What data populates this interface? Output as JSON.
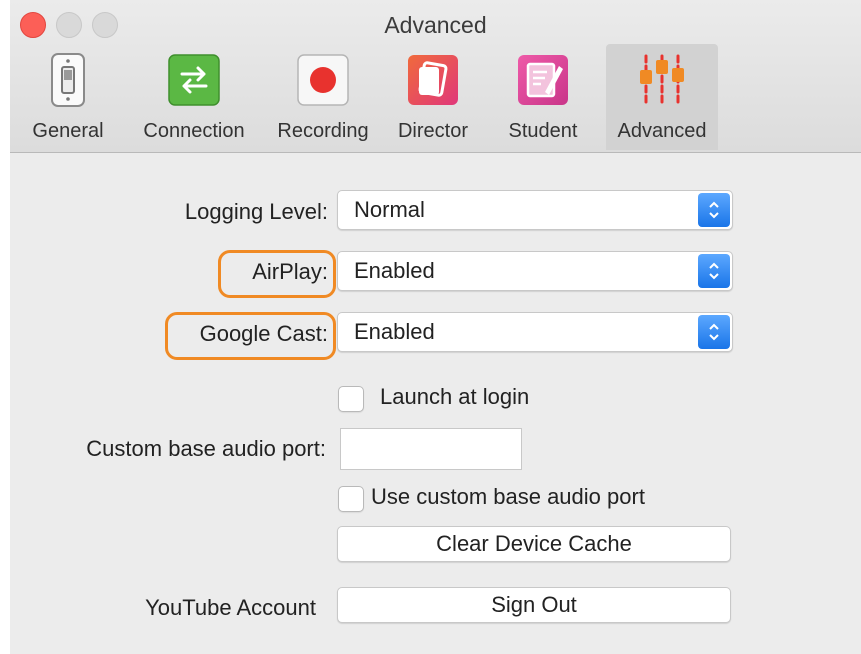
{
  "window": {
    "title": "Advanced"
  },
  "toolbar": {
    "items": [
      {
        "label": "General",
        "icon": "switch-icon"
      },
      {
        "label": "Connection",
        "icon": "arrows-swap-icon",
        "color": "#5bb844"
      },
      {
        "label": "Recording",
        "icon": "record-icon",
        "color": "#e8322e"
      },
      {
        "label": "Director",
        "icon": "director-icon",
        "color": "#e8466f"
      },
      {
        "label": "Student",
        "icon": "student-icon",
        "color": "#e0479a"
      },
      {
        "label": "Advanced",
        "icon": "sliders-icon",
        "color": "#f08a24",
        "selected": true
      }
    ]
  },
  "settings": {
    "logging_level": {
      "label": "Logging Level:",
      "value": "Normal"
    },
    "airplay": {
      "label": "AirPlay:",
      "value": "Enabled"
    },
    "google_cast": {
      "label": "Google Cast:",
      "value": "Enabled"
    },
    "launch_at_login": {
      "label": "Launch at login",
      "checked": false
    },
    "custom_port": {
      "label": "Custom base audio port:",
      "value": ""
    },
    "use_custom_port": {
      "label": "Use custom base audio port",
      "checked": false
    },
    "clear_cache": {
      "label": "Clear Device Cache"
    },
    "youtube": {
      "label": "YouTube Account",
      "button": "Sign Out"
    }
  },
  "colors": {
    "highlight": "#f08a24",
    "select_accent": "#1a75e8"
  }
}
